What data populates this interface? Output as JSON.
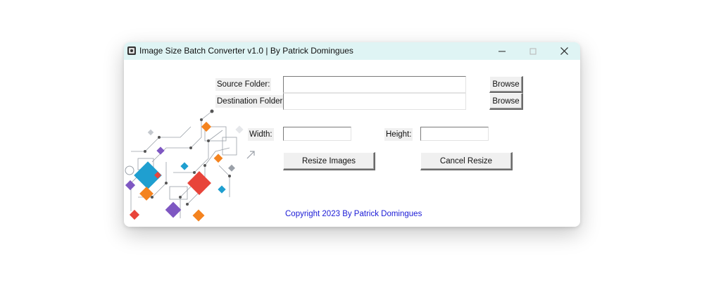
{
  "window": {
    "title": "Image Size Batch Converter v1.0 | By Patrick Domingues"
  },
  "form": {
    "source_label": "Source Folder:",
    "source_value": "",
    "destination_label": "Destination Folder:",
    "destination_value": "",
    "browse_label": "Browse",
    "width_label": "Width:",
    "width_value": "",
    "height_label": "Height:",
    "height_value": "",
    "resize_button": "Resize Images",
    "cancel_button": "Cancel Resize"
  },
  "footer": {
    "copyright": "Copyright 2023 By Patrick Domingues"
  },
  "colors": {
    "titlebar": "#dff4f4",
    "copyright_text": "#1a1ad6"
  }
}
